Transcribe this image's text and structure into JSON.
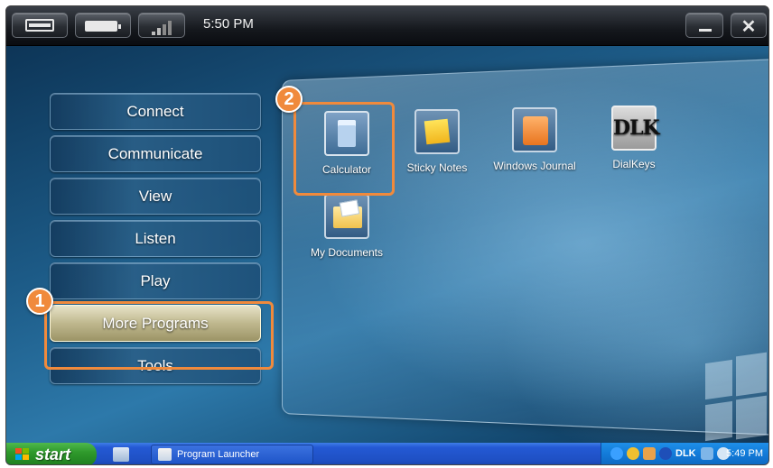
{
  "statusbar": {
    "clock": "5:50 PM"
  },
  "menu": {
    "items": [
      {
        "label": "Connect"
      },
      {
        "label": "Communicate"
      },
      {
        "label": "View"
      },
      {
        "label": "Listen"
      },
      {
        "label": "Play"
      },
      {
        "label": "More Programs"
      },
      {
        "label": "Tools"
      }
    ]
  },
  "programs": [
    {
      "label": "Calculator",
      "icon": "calculator-icon"
    },
    {
      "label": "Sticky Notes",
      "icon": "sticky-notes-icon"
    },
    {
      "label": "Windows Journal",
      "icon": "journal-icon"
    },
    {
      "label": "DialKeys",
      "icon": "dialkeys-icon",
      "icon_text": "DLK"
    },
    {
      "label": "My Documents",
      "icon": "folder-icon"
    }
  ],
  "callouts": {
    "step1": "1",
    "step2": "2"
  },
  "taskbar": {
    "start_label": "start",
    "task_label": "Program Launcher",
    "tray_clock": "5:49 PM",
    "tray_dlk": "DLK"
  },
  "colors": {
    "callout": "#f08a3c",
    "taskbar": "#2459d4",
    "start": "#2f9a2c"
  }
}
